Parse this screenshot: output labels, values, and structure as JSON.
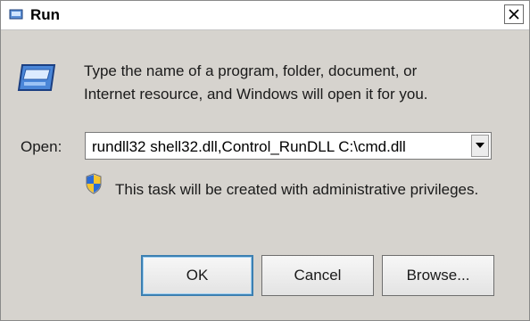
{
  "window": {
    "title": "Run",
    "title_icon": "run-icon",
    "close_icon": "close-icon"
  },
  "dialog": {
    "description_line1": "Type the name of a program, folder, document, or",
    "description_line2": "Internet resource, and Windows will open it for you.",
    "run_icon": "run-icon",
    "open_label": "Open:",
    "open_value": "rundll32 shell32.dll,Control_RunDLL C:\\cmd.dll",
    "dropdown_icon": "chevron-down-icon",
    "admin_icon": "uac-shield-icon",
    "admin_text": "This task will be created with administrative privileges."
  },
  "buttons": {
    "ok": "OK",
    "cancel": "Cancel",
    "browse": "Browse..."
  },
  "colors": {
    "dialog_bg": "#d6d3ce",
    "default_button_border": "#3c7fb1"
  }
}
